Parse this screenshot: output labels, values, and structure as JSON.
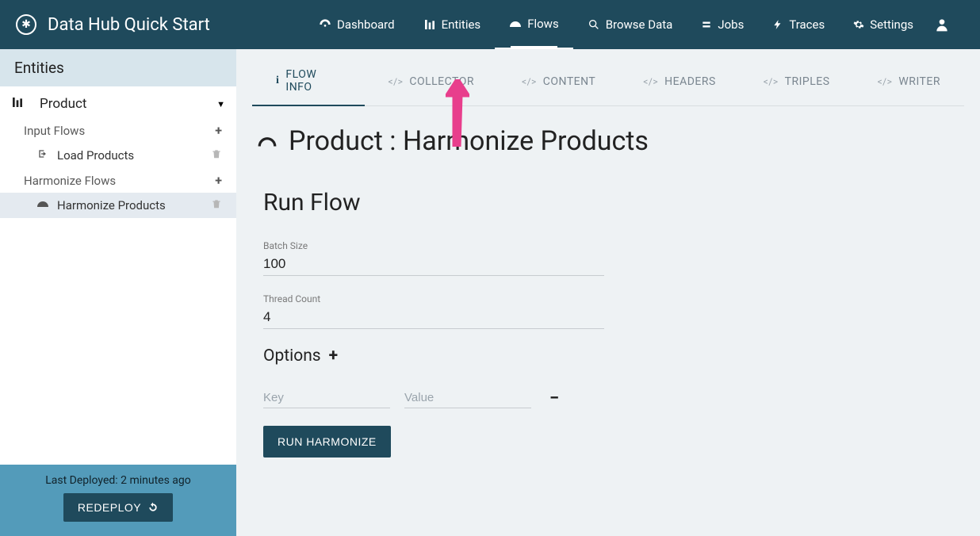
{
  "brand": "Data Hub Quick Start",
  "nav": {
    "dashboard": "Dashboard",
    "entities": "Entities",
    "flows": "Flows",
    "browse": "Browse Data",
    "jobs": "Jobs",
    "traces": "Traces",
    "settings": "Settings"
  },
  "sidebar": {
    "header": "Entities",
    "entity": "Product",
    "input_group": "Input Flows",
    "input_item": "Load Products",
    "harm_group": "Harmonize Flows",
    "harm_item": "Harmonize Products",
    "last_deployed": "Last Deployed: 2 minutes ago",
    "redeploy": "REDEPLOY"
  },
  "tabs": {
    "flow_info": "FLOW INFO",
    "collector": "COLLECTOR",
    "content": "CONTENT",
    "headers": "HEADERS",
    "triples": "TRIPLES",
    "writer": "WRITER"
  },
  "page": {
    "title": "Product : Harmonize Products",
    "section": "Run Flow",
    "batch_label": "Batch Size",
    "batch_value": "100",
    "thread_label": "Thread Count",
    "thread_value": "4",
    "options": "Options",
    "key_ph": "Key",
    "value_ph": "Value",
    "run": "RUN HARMONIZE"
  }
}
